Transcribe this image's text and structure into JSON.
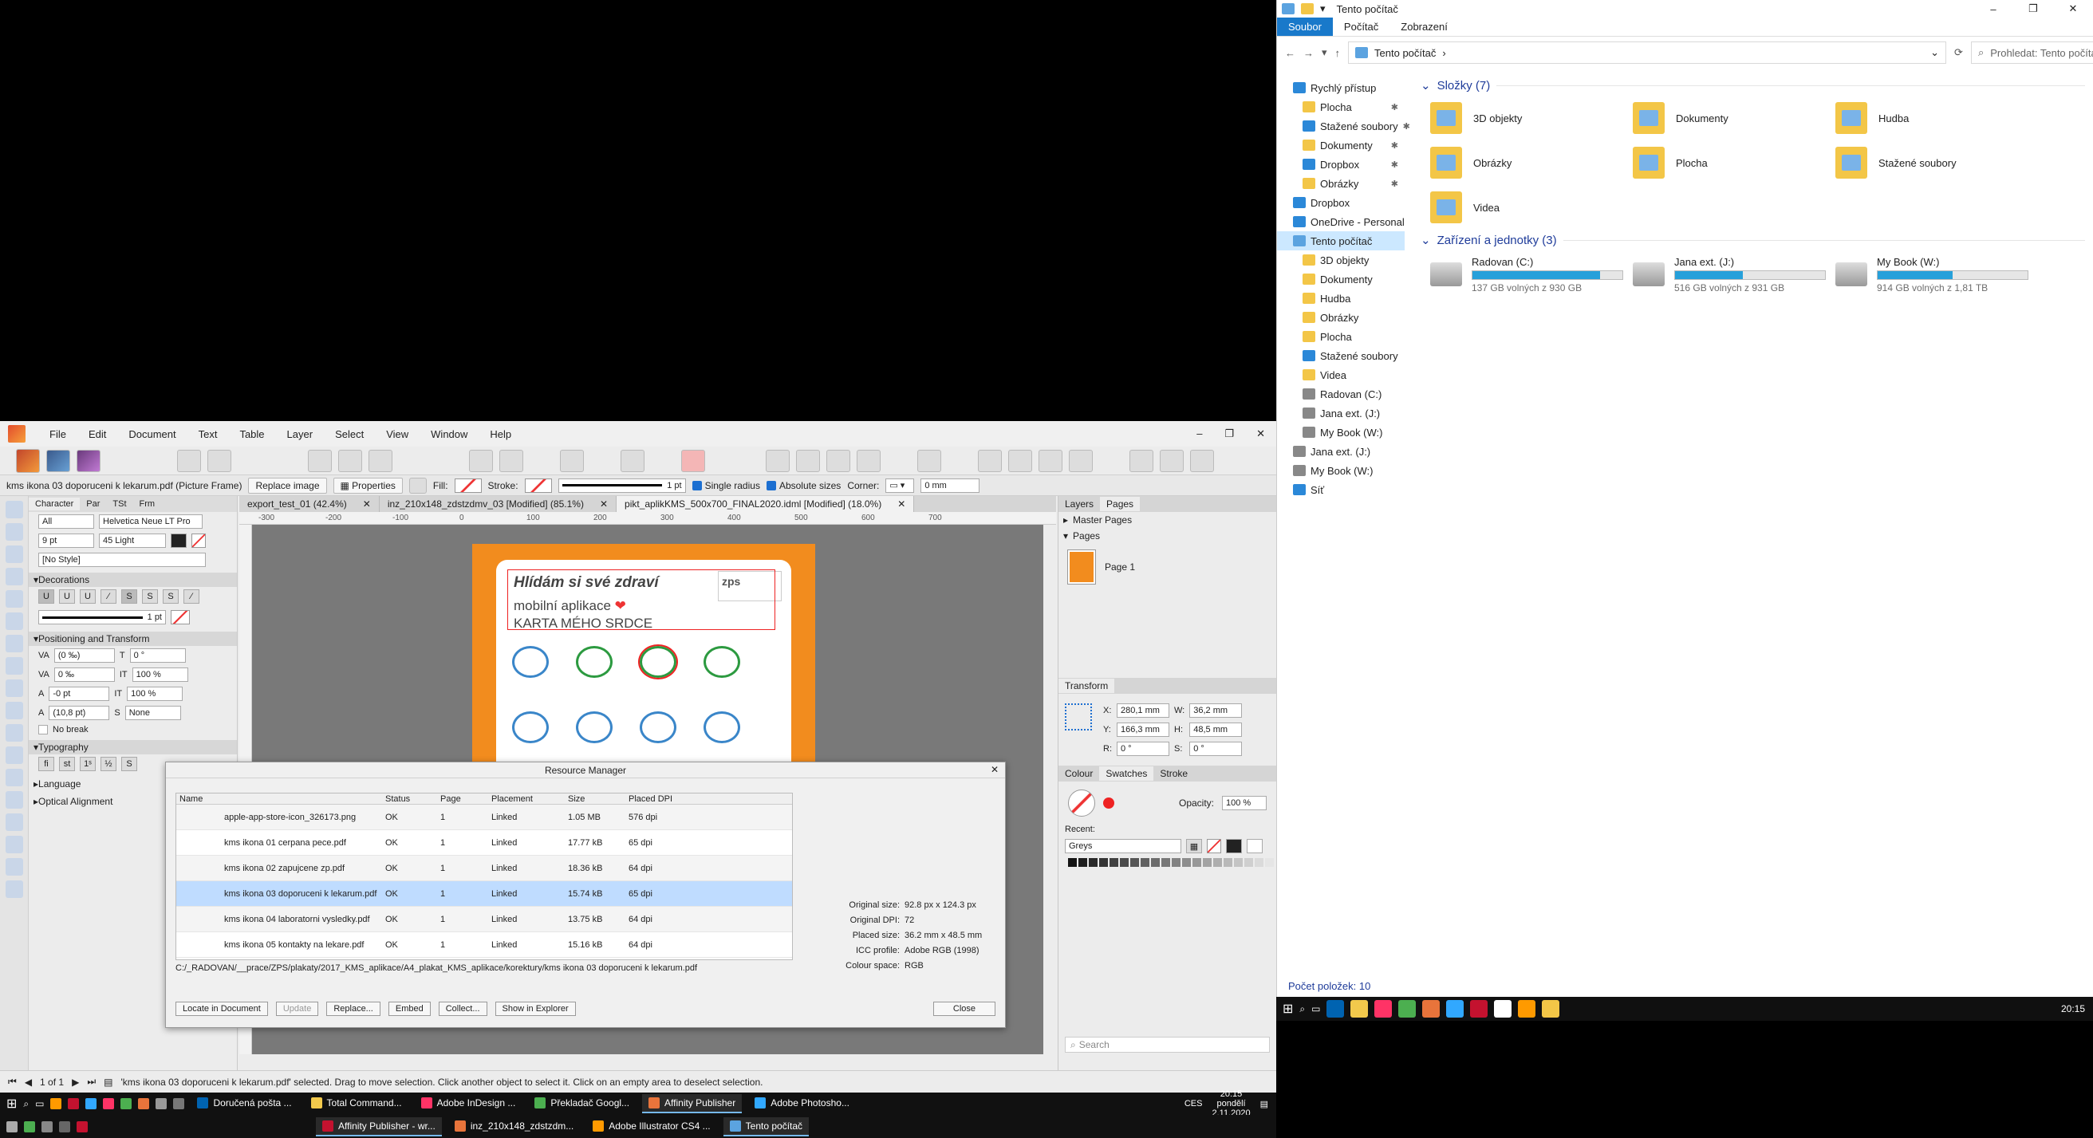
{
  "explorer": {
    "title": "Tento počítač",
    "ribbon": [
      "Soubor",
      "Počítač",
      "Zobrazení"
    ],
    "address": "Tento počítač",
    "search_placeholder": "Prohledat: Tento počítač",
    "nav": [
      {
        "label": "Rychlý přístup",
        "icon": "star-icon",
        "level": 0
      },
      {
        "label": "Plocha",
        "icon": "folder-icon",
        "level": 1,
        "pinned": true
      },
      {
        "label": "Stažené soubory",
        "icon": "download-icon",
        "level": 1,
        "pinned": true
      },
      {
        "label": "Dokumenty",
        "icon": "folder-icon",
        "level": 1,
        "pinned": true
      },
      {
        "label": "Dropbox",
        "icon": "dropbox-icon",
        "level": 1,
        "pinned": true
      },
      {
        "label": "Obrázky",
        "icon": "folder-icon",
        "level": 1,
        "pinned": true
      },
      {
        "label": "Dropbox",
        "icon": "dropbox-icon",
        "level": 0
      },
      {
        "label": "OneDrive - Personal",
        "icon": "cloud-icon",
        "level": 0
      },
      {
        "label": "Tento počítač",
        "icon": "pc-icon",
        "level": 0,
        "selected": true
      },
      {
        "label": "3D objekty",
        "icon": "folder-icon",
        "level": 1
      },
      {
        "label": "Dokumenty",
        "icon": "folder-icon",
        "level": 1
      },
      {
        "label": "Hudba",
        "icon": "folder-icon",
        "level": 1
      },
      {
        "label": "Obrázky",
        "icon": "folder-icon",
        "level": 1
      },
      {
        "label": "Plocha",
        "icon": "folder-icon",
        "level": 1
      },
      {
        "label": "Stažené soubory",
        "icon": "download-icon",
        "level": 1
      },
      {
        "label": "Videa",
        "icon": "folder-icon",
        "level": 1
      },
      {
        "label": "Radovan (C:)",
        "icon": "drive-icon",
        "level": 1
      },
      {
        "label": "Jana ext. (J:)",
        "icon": "drive-icon",
        "level": 1
      },
      {
        "label": "My Book (W:)",
        "icon": "drive-icon",
        "level": 1
      },
      {
        "label": "Jana ext. (J:)",
        "icon": "drive-icon",
        "level": 0
      },
      {
        "label": "My Book (W:)",
        "icon": "drive-icon",
        "level": 0
      },
      {
        "label": "Síť",
        "icon": "network-icon",
        "level": 0
      }
    ],
    "folders_header": "Složky (7)",
    "folders": [
      "3D objekty",
      "Dokumenty",
      "Hudba",
      "Obrázky",
      "Plocha",
      "Stažené soubory",
      "Videa"
    ],
    "devices_header": "Zařízení a jednotky (3)",
    "devices": [
      {
        "name": "Radovan (C:)",
        "free": "137 GB volných z 930 GB",
        "used_fraction": 0.85
      },
      {
        "name": "Jana ext. (J:)",
        "free": "516 GB volných z 931 GB",
        "used_fraction": 0.45
      },
      {
        "name": "My Book (W:)",
        "free": "914 GB volných z 1,81 TB",
        "used_fraction": 0.5
      }
    ],
    "status": "Počet položek: 10"
  },
  "taskbar_right": {
    "clock": "20:15"
  },
  "affinity": {
    "menu": [
      "File",
      "Edit",
      "Document",
      "Text",
      "Table",
      "Layer",
      "Select",
      "View",
      "Window",
      "Help"
    ],
    "context": {
      "selection": "kms ikona 03 doporuceni k lekarum.pdf (Picture Frame)",
      "replace": "Replace image",
      "properties": "Properties",
      "fill": "Fill:",
      "stroke": "Stroke:",
      "stroke_width": "1 pt",
      "single_radius": "Single radius",
      "absolute_sizes": "Absolute sizes",
      "corner": "Corner:",
      "corner_value": "0 mm"
    },
    "left_panel": {
      "tabs": [
        "Character",
        "Par",
        "TSt",
        "Frm"
      ],
      "scope": "All",
      "font": "Helvetica Neue LT Pro",
      "size": "9 pt",
      "weight": "45 Light",
      "style": "[No Style]",
      "decorations": "Decorations",
      "deco_stroke": "1 pt",
      "positioning": "Positioning and Transform",
      "pos_fields": [
        "(0 ‰)",
        "0 °",
        "0 ‰",
        "100 %",
        "-0 pt",
        "100 %",
        "(10,8 pt)",
        "None"
      ],
      "no_break": "No break",
      "typography": "Typography",
      "language": "Language",
      "optical": "Optical Alignment"
    },
    "doc_tabs": [
      {
        "label": "export_test_01 (42.4%)"
      },
      {
        "label": "inz_210x148_zdstzdmv_03 [Modified] (85.1%)"
      },
      {
        "label": "pikt_aplikKMS_500x700_FINAL2020.idml [Modified] (18.0%)"
      }
    ],
    "ruler_marks": [
      "-300",
      "-200",
      "-100",
      "0",
      "100",
      "200",
      "300",
      "400",
      "500",
      "600",
      "700"
    ],
    "poster": {
      "title": "Hlídám si své zdraví",
      "line1": "mobilní aplikace",
      "line2": "KARTA MÉHO SRDCE",
      "logo": "zps"
    },
    "right_panel": {
      "tabs": [
        "Layers",
        "Pages"
      ],
      "master_pages": "Master Pages",
      "pages": "Pages",
      "page1": "Page 1",
      "transform_tab": "Transform",
      "x": "280,1 mm",
      "y": "166,3 mm",
      "w": "36,2 mm",
      "h": "48,5 mm",
      "r": "0 °",
      "s": "0 °",
      "colour_tabs": [
        "Colour",
        "Swatches",
        "Stroke"
      ],
      "opacity_label": "Opacity:",
      "opacity": "100 %",
      "recent": "Recent:",
      "palette": "Greys",
      "search_placeholder": "Search"
    },
    "status": {
      "page": "1 of 1",
      "message": "'kms ikona 03 doporuceni k lekarum.pdf' selected. Drag to move selection. Click another object to select it. Click on an empty area to deselect selection."
    }
  },
  "resource_manager": {
    "title": "Resource Manager",
    "columns": [
      "Name",
      "Status",
      "Page",
      "Placement",
      "Size",
      "Placed DPI"
    ],
    "rows": [
      {
        "name": "apple-app-store-icon_326173.png",
        "status": "OK",
        "page": "1",
        "placement": "Linked",
        "size": "1.05 MB",
        "dpi": "576 dpi"
      },
      {
        "name": "kms ikona 01 cerpana pece.pdf",
        "status": "OK",
        "page": "1",
        "placement": "Linked",
        "size": "17.77 kB",
        "dpi": "65 dpi"
      },
      {
        "name": "kms ikona 02 zapujcene zp.pdf",
        "status": "OK",
        "page": "1",
        "placement": "Linked",
        "size": "18.36 kB",
        "dpi": "64 dpi"
      },
      {
        "name": "kms ikona 03 doporuceni k lekarum.pdf",
        "status": "OK",
        "page": "1",
        "placement": "Linked",
        "size": "15.74 kB",
        "dpi": "65 dpi",
        "selected": true
      },
      {
        "name": "kms ikona 04 laboratorni vysledky.pdf",
        "status": "OK",
        "page": "1",
        "placement": "Linked",
        "size": "13.75 kB",
        "dpi": "64 dpi"
      },
      {
        "name": "kms ikona 05 kontakty na lekare.pdf",
        "status": "OK",
        "page": "1",
        "placement": "Linked",
        "size": "15.16 kB",
        "dpi": "64 dpi"
      }
    ],
    "path": "C:/_RADOVAN/__prace/ZPS/plakaty/2017_KMS_aplikace/A4_plakat_KMS_aplikace/korektury/kms ikona 03 doporuceni k lekarum.pdf",
    "info": [
      {
        "k": "Original size:",
        "v": "92.8 px x 124.3 px"
      },
      {
        "k": "Original DPI:",
        "v": "72"
      },
      {
        "k": "Placed size:",
        "v": "36.2 mm x 48.5 mm"
      },
      {
        "k": "ICC profile:",
        "v": "Adobe RGB (1998)"
      },
      {
        "k": "Colour space:",
        "v": "RGB"
      }
    ],
    "buttons": [
      "Locate in Document",
      "Update",
      "Replace...",
      "Embed",
      "Collect...",
      "Show in Explorer"
    ],
    "close": "Close"
  },
  "taskbar1": {
    "apps": [
      "Doručená pošta ...",
      "Total Command...",
      "Adobe InDesign ...",
      "Překladač Googl...",
      "Affinity Publisher",
      "Adobe Photosho..."
    ],
    "lang": "CES",
    "time": "20:15",
    "day": "pondělí",
    "date": "2.11.2020"
  },
  "taskbar2": {
    "apps": [
      "Affinity Publisher - wr...",
      "inz_210x148_zdstzdm...",
      "Adobe Illustrator CS4 ...",
      "Tento počítač"
    ]
  }
}
